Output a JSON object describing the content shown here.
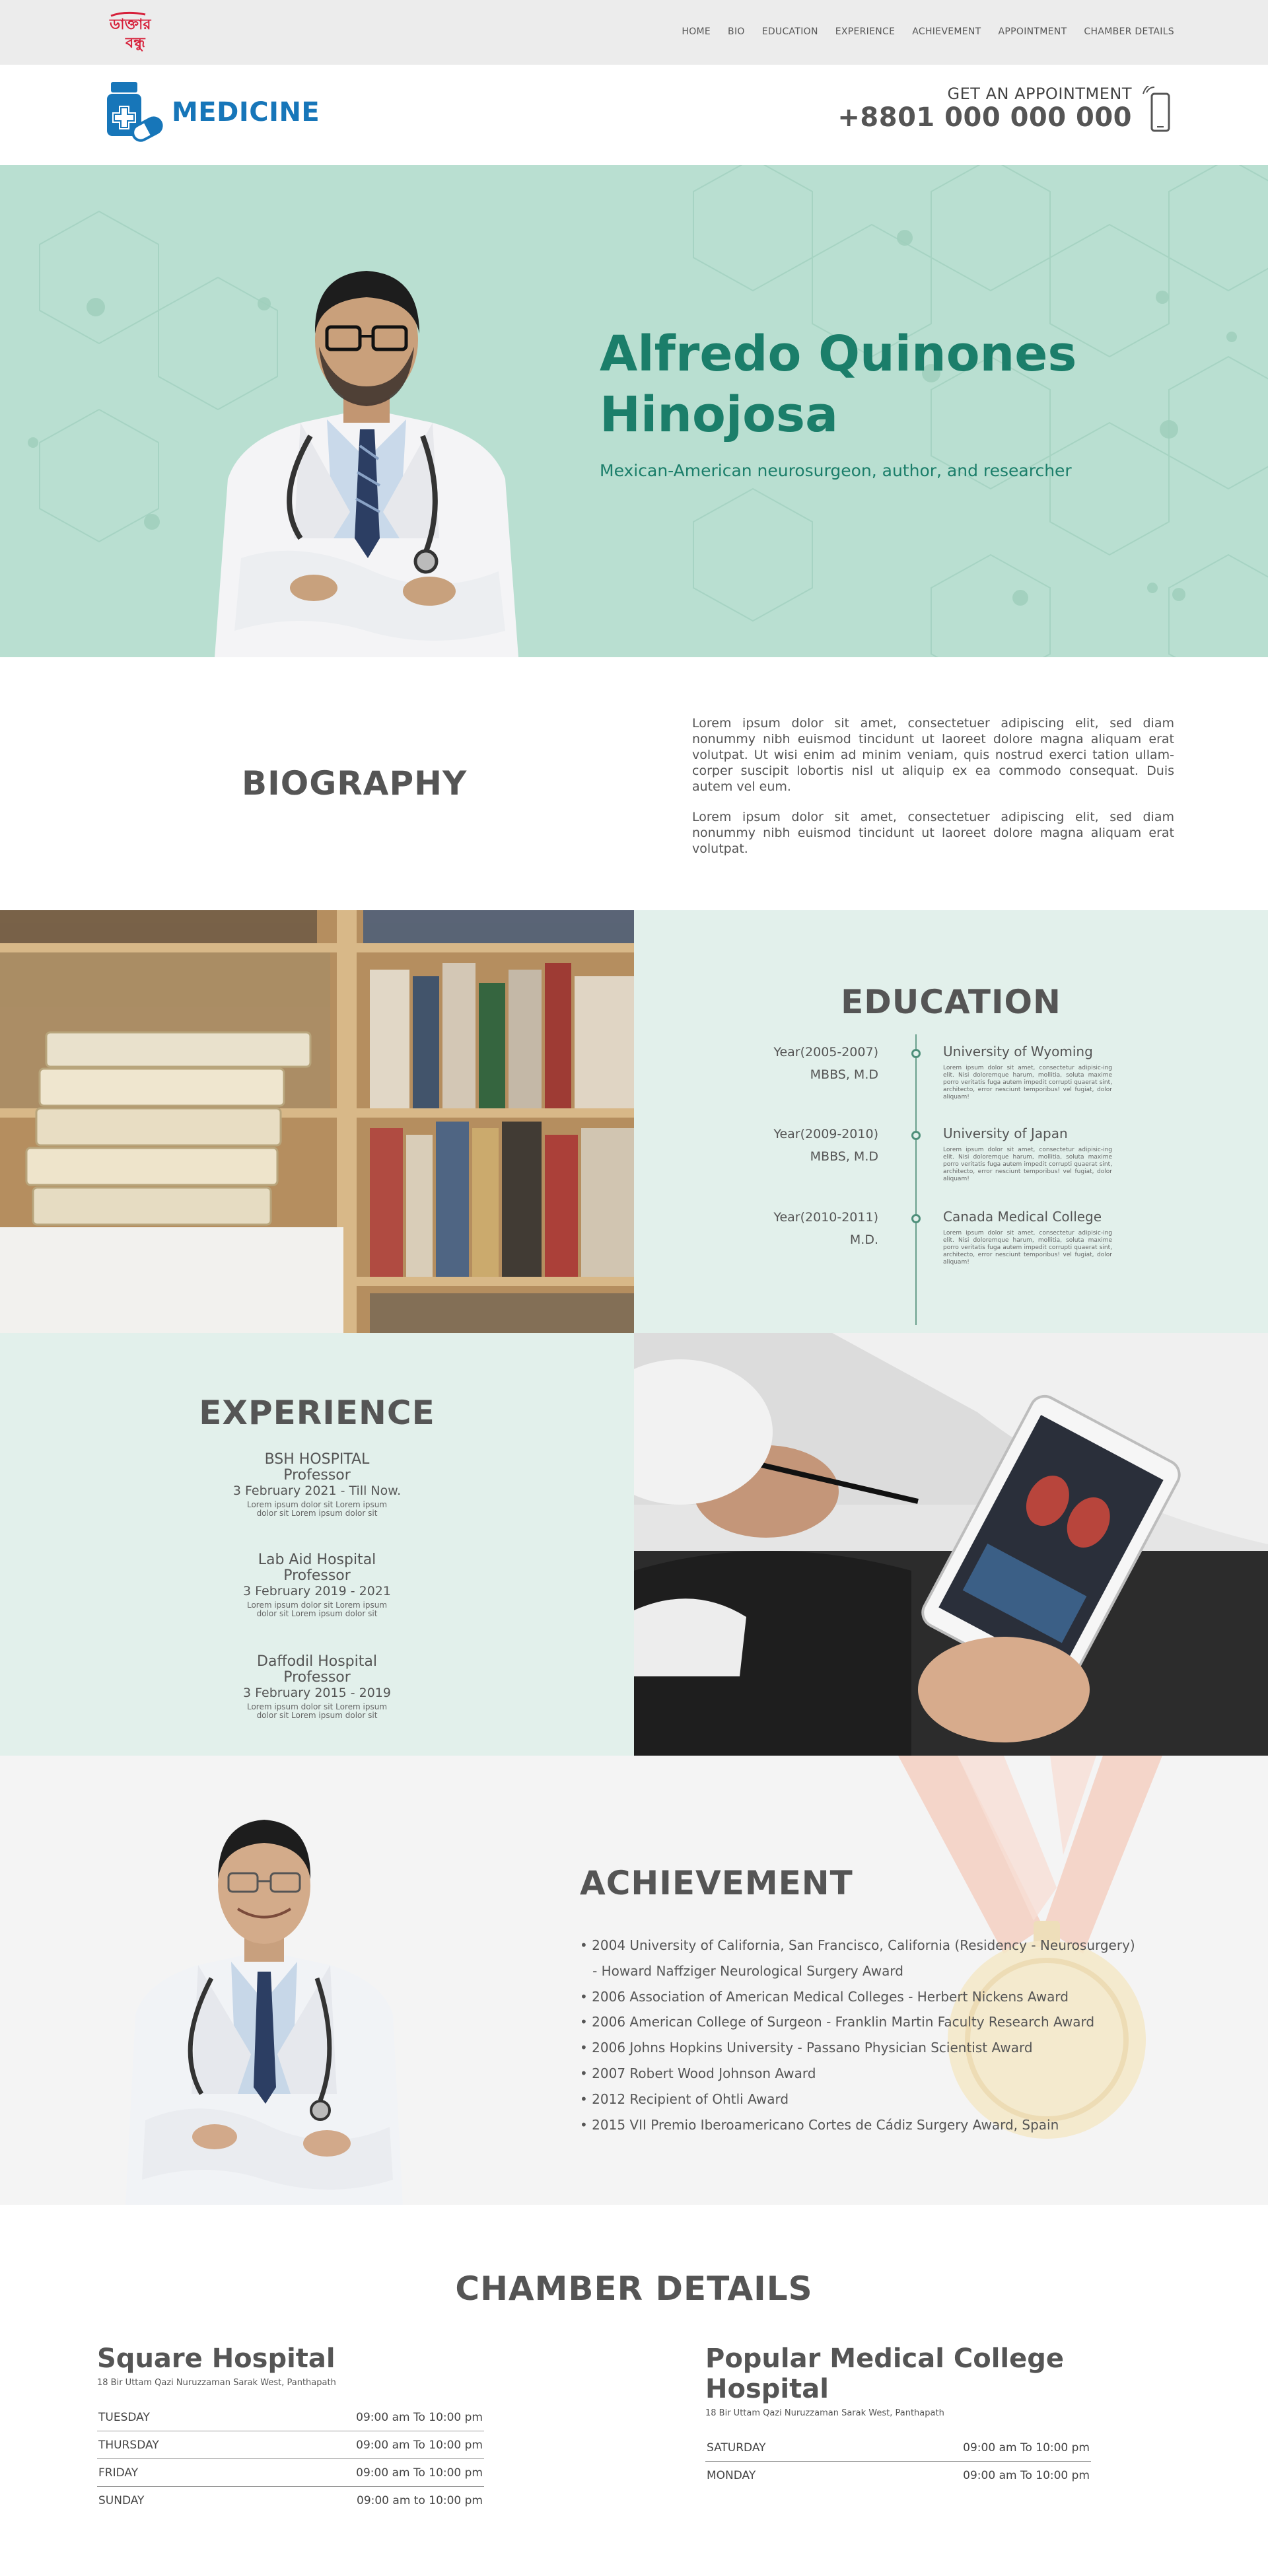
{
  "topnav": {
    "logo_text": "ডাক্তার বন্ধু",
    "links": [
      "HOME",
      "BIO",
      "EDUCATION",
      "EXPERIENCE",
      "ACHIEVEMENT",
      "APPOINTMENT",
      "CHAMBER DETAILS"
    ]
  },
  "brand": {
    "name": "MEDICINE",
    "appointment_label": "GET AN APPOINTMENT",
    "phone": "+8801 000 000 000"
  },
  "hero": {
    "name_line1": "Alfredo Quinones",
    "name_line2": "Hinojosa",
    "subtitle": "Mexican-American neurosurgeon, author, and researcher"
  },
  "bio": {
    "title": "BIOGRAPHY",
    "para1": "Lorem ipsum dolor sit amet, consectetuer adipiscing elit, sed diam nonummy nibh euismod tincidunt ut laoreet dolore magna aliquam erat volutpat. Ut wisi enim ad minim veniam, quis nostrud exerci tation ullam-corper suscipit lobortis nisl ut aliquip ex ea commodo consequat. Duis autem vel eum.",
    "para2": "Lorem ipsum dolor sit amet, consectetuer adipiscing elit, sed diam nonummy nibh euismod tincidunt ut laoreet dolore magna aliquam erat volutpat."
  },
  "education": {
    "title": "EDUCATION",
    "items": [
      {
        "year": "Year(2005-2007)",
        "degree": "MBBS, M.D",
        "school": "University of Wyoming",
        "desc": "Lorem ipsum dolor sit amet, consectetur adipisic-ing elit. Nisi doloremque harum, mollitia, soluta maxime porro veritatis fuga autem impedit corrupti quaerat sint, architecto, error nesciunt temporibus! vel fugiat, dolor aliquam!"
      },
      {
        "year": "Year(2009-2010)",
        "degree": "MBBS, M.D",
        "school": "University of Japan",
        "desc": "Lorem ipsum dolor sit amet, consectetur adipisic-ing elit. Nisi doloremque harum, mollitia, soluta maxime porro veritatis fuga autem impedit corrupti quaerat sint, architecto, error nesciunt temporibus! vel fugiat, dolor aliquam!"
      },
      {
        "year": "Year(2010-2011)",
        "degree": "M.D.",
        "school": "Canada Medical College",
        "desc": "Lorem ipsum dolor sit amet, consectetur adipisic-ing elit. Nisi doloremque harum, mollitia, soluta maxime porro veritatis fuga autem impedit corrupti quaerat sint, architecto, error nesciunt temporibus! vel fugiat, dolor aliquam!"
      }
    ]
  },
  "experience": {
    "title": "EXPERIENCE",
    "items": [
      {
        "hospital": "BSH HOSPITAL",
        "role": "Professor",
        "dates": "3 February  2021 - Till Now.",
        "desc": "Lorem ipsum dolor sit Lorem ipsum dolor sit  Lorem ipsum dolor sit"
      },
      {
        "hospital": "Lab Aid Hospital",
        "role": "Professor",
        "dates": "3 February  2019 - 2021",
        "desc": "Lorem ipsum dolor sit Lorem ipsum dolor sit  Lorem ipsum dolor sit"
      },
      {
        "hospital": "Daffodil Hospital",
        "role": "Professor",
        "dates": "3 February  2015 - 2019",
        "desc": "Lorem ipsum dolor sit Lorem ipsum dolor sit  Lorem ipsum dolor sit"
      }
    ]
  },
  "achievement": {
    "title": "ACHIEVEMENT",
    "items": [
      "• 2004 University of California, San Francisco, California (Residency - Neurosurgery)",
      "   - Howard Naffziger Neurological Surgery Award",
      "• 2006 Association of American Medical Colleges - Herbert Nickens Award",
      "• 2006 American College of Surgeon - Franklin Martin Faculty Research Award",
      "• 2006 Johns Hopkins University - Passano Physician Scientist Award",
      "• 2007 Robert Wood Johnson Award",
      "• 2012 Recipient of Ohtli Award",
      "• 2015 VII Premio Iberoamericano Cortes de Cádiz Surgery Award, Spain"
    ]
  },
  "chamber": {
    "title": "CHAMBER DETAILS",
    "hospitals": [
      {
        "name": "Square Hospital",
        "address": "18 Bir Uttam Qazi Nuruzzaman Sarak West, Panthapath",
        "schedule": [
          {
            "day": "TUESDAY",
            "time": "09:00 am To 10:00 pm"
          },
          {
            "day": "THURSDAY",
            "time": "09:00 am To 10:00 pm"
          },
          {
            "day": "FRIDAY",
            "time": "09:00 am To 10:00 pm"
          },
          {
            "day": "SUNDAY",
            "time": "09:00 am to 10:00 pm"
          }
        ]
      },
      {
        "name": "Popular Medical College Hospital",
        "address": "18 Bir Uttam Qazi Nuruzzaman Sarak West, Panthapath",
        "schedule": [
          {
            "day": "SATURDAY",
            "time": "09:00 am To 10:00 pm"
          },
          {
            "day": "MONDAY",
            "time": "09:00 am To 10:00 pm"
          }
        ]
      }
    ]
  },
  "colors": {
    "brand_blue": "#1776b9",
    "hero_green": "#1b7e6a",
    "hero_bg": "#b9dfd1",
    "panel_bg": "#e2f0eb",
    "logo_red": "#d6203a"
  }
}
